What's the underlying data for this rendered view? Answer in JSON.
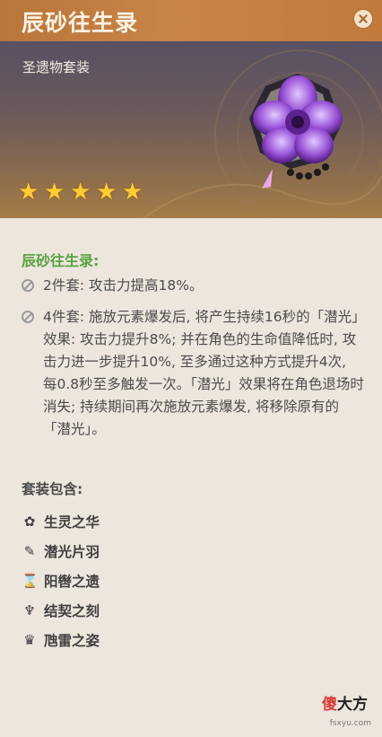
{
  "header": {
    "title": "辰砂往生录",
    "close_icon": "close-icon"
  },
  "banner": {
    "subtitle": "圣遗物套装",
    "stars": 5,
    "star_color": "#ffcc33"
  },
  "set": {
    "name": "辰砂往生录:",
    "bonus2": "2件套: 攻击力提高18%。",
    "bonus4": "4件套: 施放元素爆发后, 将产生持续16秒的「潜光」效果: 攻击力提升8%; 并在角色的生命值降低时, 攻击力进一步提升10%, 至多通过这种方式提升4次, 每0.8秒至多触发一次。「潜光」效果将在角色退场时消失; 持续期间再次施放元素爆发, 将移除原有的「潜光」。",
    "bonus_color": "#5aa241"
  },
  "pieces_label": "套装包含:",
  "pieces": [
    {
      "icon": "flower-icon",
      "name": "生灵之华"
    },
    {
      "icon": "feather-icon",
      "name": "潜光片羽"
    },
    {
      "icon": "hourglass-icon",
      "name": "阳辔之遗"
    },
    {
      "icon": "goblet-icon",
      "name": "结契之刻"
    },
    {
      "icon": "crown-icon",
      "name": "虺雷之姿"
    }
  ],
  "watermark": {
    "red": "傻",
    "black": "大方",
    "small": "fsxyu.com"
  }
}
